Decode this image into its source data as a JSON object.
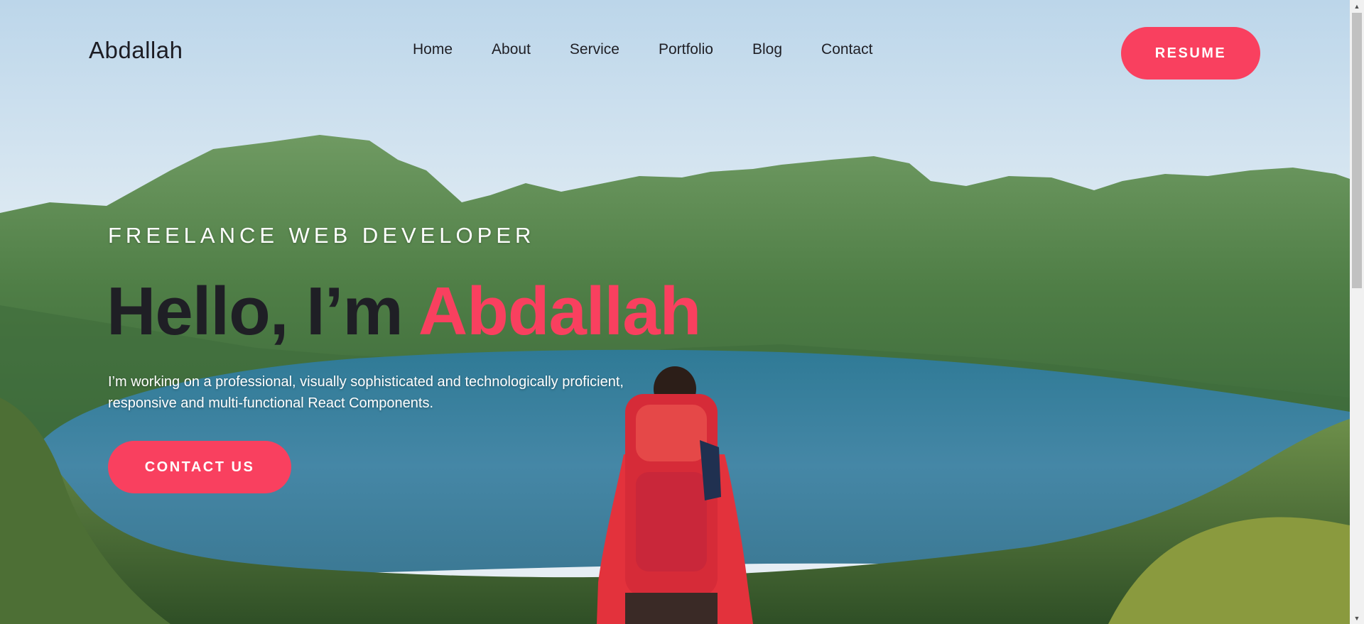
{
  "header": {
    "logo": "Abdallah",
    "nav": [
      "Home",
      "About",
      "Service",
      "Portfolio",
      "Blog",
      "Contact"
    ],
    "resume_label": "RESUME"
  },
  "hero": {
    "subtitle": "FREELANCE WEB DEVELOPER",
    "headline_prefix": "Hello, I’m ",
    "headline_name": "Abdallah",
    "description": "I’m working on a professional, visually sophisticated and technologically proficient, responsive and multi-functional React Components.",
    "contact_label": "CONTACT US"
  },
  "colors": {
    "accent": "#f9405f",
    "text_dark": "#1f1f25",
    "sky": "#c9dbe8",
    "lake": "#3e7f9c",
    "forest": "#4d7f42"
  },
  "scrollbar": {
    "up_icon": "▲",
    "down_icon": "▼"
  }
}
